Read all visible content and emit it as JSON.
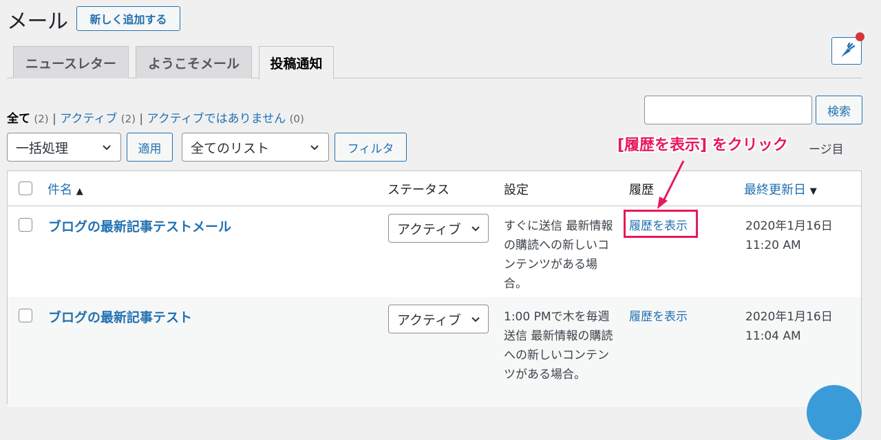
{
  "header": {
    "title": "メール",
    "add_new_label": "新しく追加する"
  },
  "tabs": [
    {
      "label": "ニュースレター",
      "active": false
    },
    {
      "label": "ようこそメール",
      "active": false
    },
    {
      "label": "投稿通知",
      "active": true
    }
  ],
  "help_icon": "carrot-icon",
  "filters": {
    "all_label": "全て",
    "all_count": "(2)",
    "active_label": "アクティブ",
    "active_count": "(2)",
    "inactive_label": "アクティブではありません",
    "inactive_count": "(0)",
    "separator": "|"
  },
  "search": {
    "value": "",
    "button_label": "検索"
  },
  "bulk": {
    "action_value": "一括処理",
    "apply_label": "適用",
    "list_value": "全てのリスト",
    "filter_label": "フィルタ",
    "pages_text": "ージ目"
  },
  "annotation": {
    "callout": "[履歴を表示] をクリック"
  },
  "table": {
    "columns": {
      "name": "件名",
      "name_sort": "▲",
      "status": "ステータス",
      "settings": "設定",
      "history": "履歴",
      "updated": "最終更新日",
      "updated_sort": "▼"
    },
    "rows": [
      {
        "name": "ブログの最新記事テストメール",
        "status": "アクティブ",
        "settings": "すぐに送信 最新情報の購読への新しいコンテンツがある場合。",
        "history": "履歴を表示",
        "date": "2020年1月16日",
        "time": "11:20 AM"
      },
      {
        "name": "ブログの最新記事テスト",
        "status": "アクティブ",
        "settings": "1:00 PMで木を毎週送信 最新情報の購読への新しいコンテンツがある場合。",
        "history": "履歴を表示",
        "date": "2020年1月16日",
        "time": "11:04 AM"
      }
    ]
  },
  "colors": {
    "accent": "#2271b1",
    "annotation": "#e8185a",
    "notification": "#d63638"
  }
}
